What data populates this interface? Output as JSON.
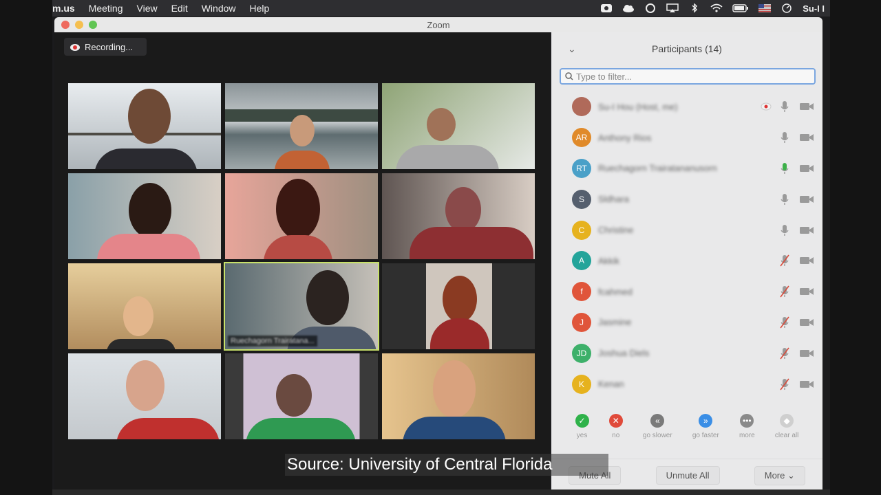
{
  "menubar": {
    "app": "m.us",
    "items": [
      "Meeting",
      "View",
      "Edit",
      "Window",
      "Help"
    ],
    "user": "Su-I I"
  },
  "window": {
    "title": "Zoom"
  },
  "meeting": {
    "recording_label": "Recording...",
    "active_speaker_name": "Ruechagorn Trairatana..."
  },
  "panel": {
    "title": "Participants (14)",
    "filter_placeholder": "Type to filter...",
    "participants": [
      {
        "initials": "",
        "name": "Su-I Hou (Host, me)",
        "color": "#b06a5a",
        "mic": "on",
        "recording": true
      },
      {
        "initials": "AR",
        "name": "Anthony Rios",
        "color": "#e08a2a",
        "mic": "on"
      },
      {
        "initials": "RT",
        "name": "Ruechagorn Trairatananusorn",
        "color": "#4aa0c8",
        "mic": "speaking"
      },
      {
        "initials": "S",
        "name": "Sldhara",
        "color": "#555f6e",
        "mic": "on"
      },
      {
        "initials": "C",
        "name": "Christine",
        "color": "#e6b21e",
        "mic": "on"
      },
      {
        "initials": "A",
        "name": "Akkik",
        "color": "#23a49a",
        "mic": "muted"
      },
      {
        "initials": "f",
        "name": "fcahmed",
        "color": "#e0553a",
        "mic": "muted"
      },
      {
        "initials": "J",
        "name": "Jasmine",
        "color": "#e0553a",
        "mic": "muted"
      },
      {
        "initials": "JD",
        "name": "Joshua Diels",
        "color": "#3db06a",
        "mic": "muted"
      },
      {
        "initials": "K",
        "name": "Kenan",
        "color": "#e6b21e",
        "mic": "muted"
      }
    ],
    "reactions": [
      {
        "label": "yes",
        "glyph": "✓",
        "color": "#2fb24a"
      },
      {
        "label": "no",
        "glyph": "✕",
        "color": "#e04a3a"
      },
      {
        "label": "go slower",
        "glyph": "«",
        "color": "#7a7a7a"
      },
      {
        "label": "go faster",
        "glyph": "»",
        "color": "#3a8ee6"
      },
      {
        "label": "more",
        "glyph": "•••",
        "color": "#8a8a8a"
      },
      {
        "label": "clear all",
        "glyph": "◆",
        "color": "#cfcfcf"
      }
    ],
    "footer": {
      "mute_all": "Mute All",
      "unmute_all": "Unmute All",
      "more": "More ⌄"
    }
  },
  "caption": "Source: University of Central Florida"
}
